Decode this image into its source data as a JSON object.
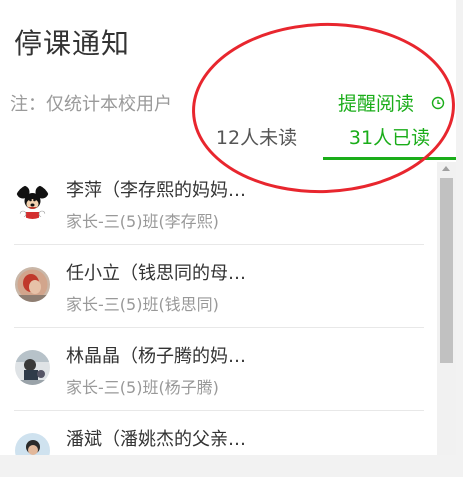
{
  "header": {
    "title": "停课通知",
    "note": "注：仅统计本校用户",
    "remind_label": "提醒阅读"
  },
  "tabs": [
    {
      "label": "12人未读",
      "active": false
    },
    {
      "label": "31人已读",
      "active": true
    }
  ],
  "readers": [
    {
      "name": "李萍（李存熙的妈妈）",
      "display_name": "李萍（李存熙的妈妈…",
      "sub": "家长-三(5)班(李存熙)",
      "avatar": "cartoon-mouse-avatar"
    },
    {
      "name": "任小立（钱思同的母亲）",
      "display_name": "任小立（钱思同的母…",
      "sub": "家长-三(5)班(钱思同)",
      "avatar": "photo-avatar"
    },
    {
      "name": "林晶晶（杨子腾的妈妈）",
      "display_name": "林晶晶（杨子腾的妈…",
      "sub": "家长-三(5)班(杨子腾)",
      "avatar": "photo-avatar"
    },
    {
      "name": "潘斌（潘姚杰的父亲）",
      "display_name": "潘斌（潘姚杰的父亲…",
      "sub": "",
      "avatar": "photo-avatar"
    }
  ],
  "colors": {
    "accent": "#1aad19",
    "annotation": "#e8262e"
  },
  "icons": {
    "remind": "clock-icon"
  }
}
